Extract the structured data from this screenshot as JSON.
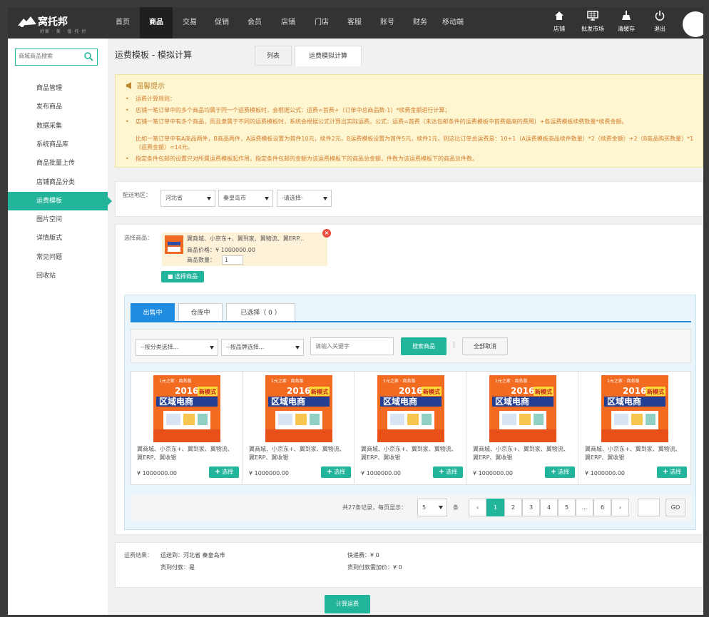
{
  "brand": {
    "name": "窝托邦",
    "slogan": "好家 · 美 · 值 托 付"
  },
  "topnav": {
    "items": [
      "首页",
      "商品",
      "交易",
      "促销",
      "会员",
      "店铺",
      "门店",
      "客服",
      "账号",
      "财务",
      "移动端"
    ],
    "active_index": 1,
    "icons": [
      {
        "label": "店铺",
        "icon": "house-icon"
      },
      {
        "label": "批发市场",
        "icon": "monitor-icon"
      },
      {
        "label": "清缓存",
        "icon": "broom-icon"
      },
      {
        "label": "退出",
        "icon": "power-icon"
      }
    ]
  },
  "sidebar": {
    "search_placeholder": "商城商品搜索",
    "items": [
      "商品管理",
      "发布商品",
      "数据采集",
      "系统商品库",
      "商品批量上传",
      "店铺商品分类",
      "运费模板",
      "图片空间",
      "详情版式",
      "常见问题",
      "回收站"
    ],
    "active_index": 6
  },
  "page": {
    "title": "运费模板 - 模拟计算",
    "tabs": [
      "列表",
      "运费模拟计算"
    ],
    "active_tab": 1
  },
  "notice": {
    "title": "温馨提示",
    "lines": [
      "运费计算规则：",
      "店铺一笔订单中的多个商品均属于同一个运费模板时，会根据公式：运费=首费+（订单中总商品数-1）*续费金额进行计算；",
      "店铺一笔订单中有多个商品，而且隶属于不同的运费模板时，系统会根据公式计算出实际运费。公式：运费=首费（未达包邮条件的运费模板中首费最高的费用）+各运费模板续费数量*续费金额。",
      "比如一笔订单中有A商品两件，B商品两件，A运费模板设置为首件10元，续件2元，B运费模板设置为首件5元，续件1元，则这比订单总运费是：10+1（A运费模板商品续件数量）*2（续费金额）+2（B商品购买数量）*1（运费金额）=14元。",
      "指定条件包邮的设置只对所属运费模板起作用，指定条件包邮的金额为该运费模板下的商品总金额，件数为该运费模板下的商品总件数。"
    ]
  },
  "region": {
    "label": "配送地区：",
    "province": "河北省",
    "city": "秦皇岛市",
    "district": "-请选择-"
  },
  "selected": {
    "label": "选择商品：",
    "product_name": "翼商城、小京东+、翼到家、翼物流、翼ERP...",
    "price_label": "商品价格：",
    "price": "¥ 1000000.00",
    "qty_label": "商品数量：",
    "qty": "1",
    "choose_button": "选择商品"
  },
  "picker": {
    "tabs": [
      "出售中",
      "仓库中",
      "已选择（ 0 ）"
    ],
    "active_tab": 0,
    "category_placeholder": "--按分类选择...",
    "brand_placeholder": "--按品牌选择...",
    "keyword_placeholder": "请输入关键字",
    "search_button": "搜索商品",
    "separator": "|",
    "cancel_all_button": "全部取消",
    "banner": {
      "top": "1元之家 · 商务版",
      "year": "2016",
      "title": "区域电商",
      "tag": "新模式"
    },
    "products": [
      {
        "name": "翼商城、小京东+、翼到家、翼物流、翼ERP、翼收银",
        "price": "¥ 1000000.00",
        "button": "选择"
      },
      {
        "name": "翼商城、小京东+、翼到家、翼物流、翼ERP、翼收银",
        "price": "¥ 1000000.00",
        "button": "选择"
      },
      {
        "name": "翼商城、小京东+、翼到家、翼物流、翼ERP、翼收银",
        "price": "¥ 1000000.00",
        "button": "选择"
      },
      {
        "name": "翼商城、小京东+、翼到家、翼物流、翼ERP、翼收银",
        "price": "¥ 1000000.00",
        "button": "选择"
      },
      {
        "name": "翼商城、小京东+、翼到家、翼物流、翼ERP、翼收银",
        "price": "¥ 1000000.00",
        "button": "选择"
      }
    ],
    "pagination": {
      "summary": "共27条记录，每页显示：",
      "page_size": "5",
      "unit": "条",
      "prev": "‹",
      "pages": [
        "1",
        "2",
        "3",
        "4",
        "5",
        "...",
        "6"
      ],
      "active_page": "1",
      "next": "›",
      "go_button": "GO"
    }
  },
  "result": {
    "label": "运费结果：",
    "delivery_to": "运送到：河北省 秦皇岛市",
    "cod": "货到付款：是",
    "express_fee": "快递费：¥ 0",
    "cod_fee": "货到付款需加价：¥ 0",
    "calc_button": "计算运费"
  }
}
